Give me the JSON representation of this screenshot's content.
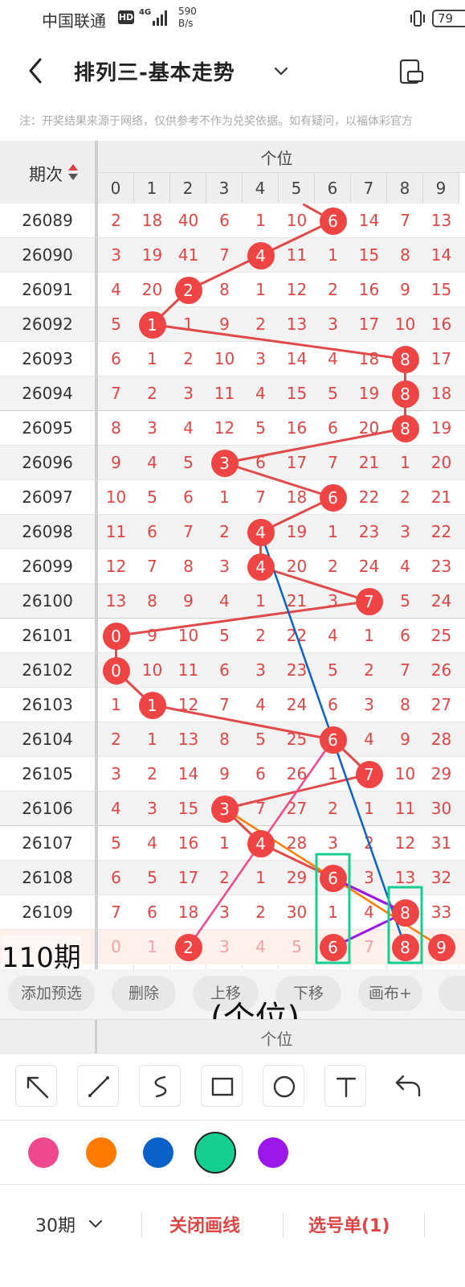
{
  "status_bar": {
    "carrier": "中国联通",
    "hd": "HD",
    "network": "4G",
    "speed_value": "590",
    "speed_unit": "B/s",
    "battery": "79"
  },
  "header": {
    "title": "排列三-基本走势",
    "notice": "注：开奖结果来源于网络，仅供参考不作为兑奖依据。如有疑问，以福体彩官方"
  },
  "chart": {
    "period_header": "期次",
    "section_title": "个位",
    "columns": [
      "0",
      "1",
      "2",
      "3",
      "4",
      "5",
      "6",
      "7",
      "8",
      "9"
    ],
    "prediction_label": "110期",
    "rows": [
      {
        "period": "26089",
        "winner": 6,
        "cells": [
          "2",
          "18",
          "40",
          "6",
          "1",
          "10",
          "6",
          "14",
          "7",
          "13"
        ]
      },
      {
        "period": "26090",
        "winner": 4,
        "cells": [
          "3",
          "19",
          "41",
          "7",
          "4",
          "11",
          "1",
          "15",
          "8",
          "14"
        ]
      },
      {
        "period": "26091",
        "winner": 2,
        "cells": [
          "4",
          "20",
          "2",
          "8",
          "1",
          "12",
          "2",
          "16",
          "9",
          "15"
        ]
      },
      {
        "period": "26092",
        "winner": 1,
        "cells": [
          "5",
          "1",
          "1",
          "9",
          "2",
          "13",
          "3",
          "17",
          "10",
          "16"
        ]
      },
      {
        "period": "26093",
        "winner": 8,
        "cells": [
          "6",
          "1",
          "2",
          "10",
          "3",
          "14",
          "4",
          "18",
          "8",
          "17"
        ]
      },
      {
        "period": "26094",
        "winner": 8,
        "cells": [
          "7",
          "2",
          "3",
          "11",
          "4",
          "15",
          "5",
          "19",
          "8",
          "18"
        ]
      },
      {
        "period": "26095",
        "winner": 8,
        "cells": [
          "8",
          "3",
          "4",
          "12",
          "5",
          "16",
          "6",
          "20",
          "8",
          "19"
        ]
      },
      {
        "period": "26096",
        "winner": 3,
        "cells": [
          "9",
          "4",
          "5",
          "3",
          "6",
          "17",
          "7",
          "21",
          "1",
          "20"
        ]
      },
      {
        "period": "26097",
        "winner": 6,
        "cells": [
          "10",
          "5",
          "6",
          "1",
          "7",
          "18",
          "6",
          "22",
          "2",
          "21"
        ]
      },
      {
        "period": "26098",
        "winner": 4,
        "cells": [
          "11",
          "6",
          "7",
          "2",
          "4",
          "19",
          "1",
          "23",
          "3",
          "22"
        ]
      },
      {
        "period": "26099",
        "winner": 4,
        "cells": [
          "12",
          "7",
          "8",
          "3",
          "4",
          "20",
          "2",
          "24",
          "4",
          "23"
        ]
      },
      {
        "period": "26100",
        "winner": 7,
        "cells": [
          "13",
          "8",
          "9",
          "4",
          "1",
          "21",
          "3",
          "7",
          "5",
          "24"
        ]
      },
      {
        "period": "26101",
        "winner": 0,
        "cells": [
          "0",
          "9",
          "10",
          "5",
          "2",
          "22",
          "4",
          "1",
          "6",
          "25"
        ]
      },
      {
        "period": "26102",
        "winner": 0,
        "cells": [
          "0",
          "10",
          "11",
          "6",
          "3",
          "23",
          "5",
          "2",
          "7",
          "26"
        ]
      },
      {
        "period": "26103",
        "winner": 1,
        "cells": [
          "1",
          "1",
          "12",
          "7",
          "4",
          "24",
          "6",
          "3",
          "8",
          "27"
        ]
      },
      {
        "period": "26104",
        "winner": 6,
        "cells": [
          "2",
          "1",
          "13",
          "8",
          "5",
          "25",
          "6",
          "4",
          "9",
          "28"
        ]
      },
      {
        "period": "26105",
        "winner": 7,
        "cells": [
          "3",
          "2",
          "14",
          "9",
          "6",
          "26",
          "1",
          "7",
          "10",
          "29"
        ]
      },
      {
        "period": "26106",
        "winner": 3,
        "cells": [
          "4",
          "3",
          "15",
          "3",
          "7",
          "27",
          "2",
          "1",
          "11",
          "30"
        ]
      },
      {
        "period": "26107",
        "winner": 4,
        "cells": [
          "5",
          "4",
          "16",
          "1",
          "4",
          "28",
          "3",
          "2",
          "12",
          "31"
        ]
      },
      {
        "period": "26108",
        "winner": 6,
        "cells": [
          "6",
          "5",
          "17",
          "2",
          "1",
          "29",
          "6",
          "3",
          "13",
          "32"
        ]
      },
      {
        "period": "26109",
        "winner": 8,
        "cells": [
          "7",
          "6",
          "18",
          "3",
          "2",
          "30",
          "1",
          "4",
          "8",
          "33"
        ]
      }
    ],
    "prediction": {
      "cells": [
        "0",
        "1",
        "2",
        "3",
        "4",
        "5",
        "6",
        "7",
        "8",
        "9"
      ],
      "selected": [
        2,
        6,
        8,
        9
      ]
    }
  },
  "actions": {
    "add": "添加预选",
    "delete": "删除",
    "up": "上移",
    "down": "下移",
    "canvas": "画布+"
  },
  "caption": "(个位)",
  "footer_header": "个位",
  "tools": [
    "arrow-tool",
    "line-tool",
    "curve-tool",
    "rect-tool",
    "circle-tool",
    "text-tool"
  ],
  "palette": [
    "#f0488e",
    "#ff7a00",
    "#0a62c8",
    "#15cf92",
    "#9b17ea"
  ],
  "selected_color": "#15cf92",
  "bottom": {
    "period_count": "30期",
    "close_lines": "关闭画线",
    "selection": "选号单(1)"
  }
}
